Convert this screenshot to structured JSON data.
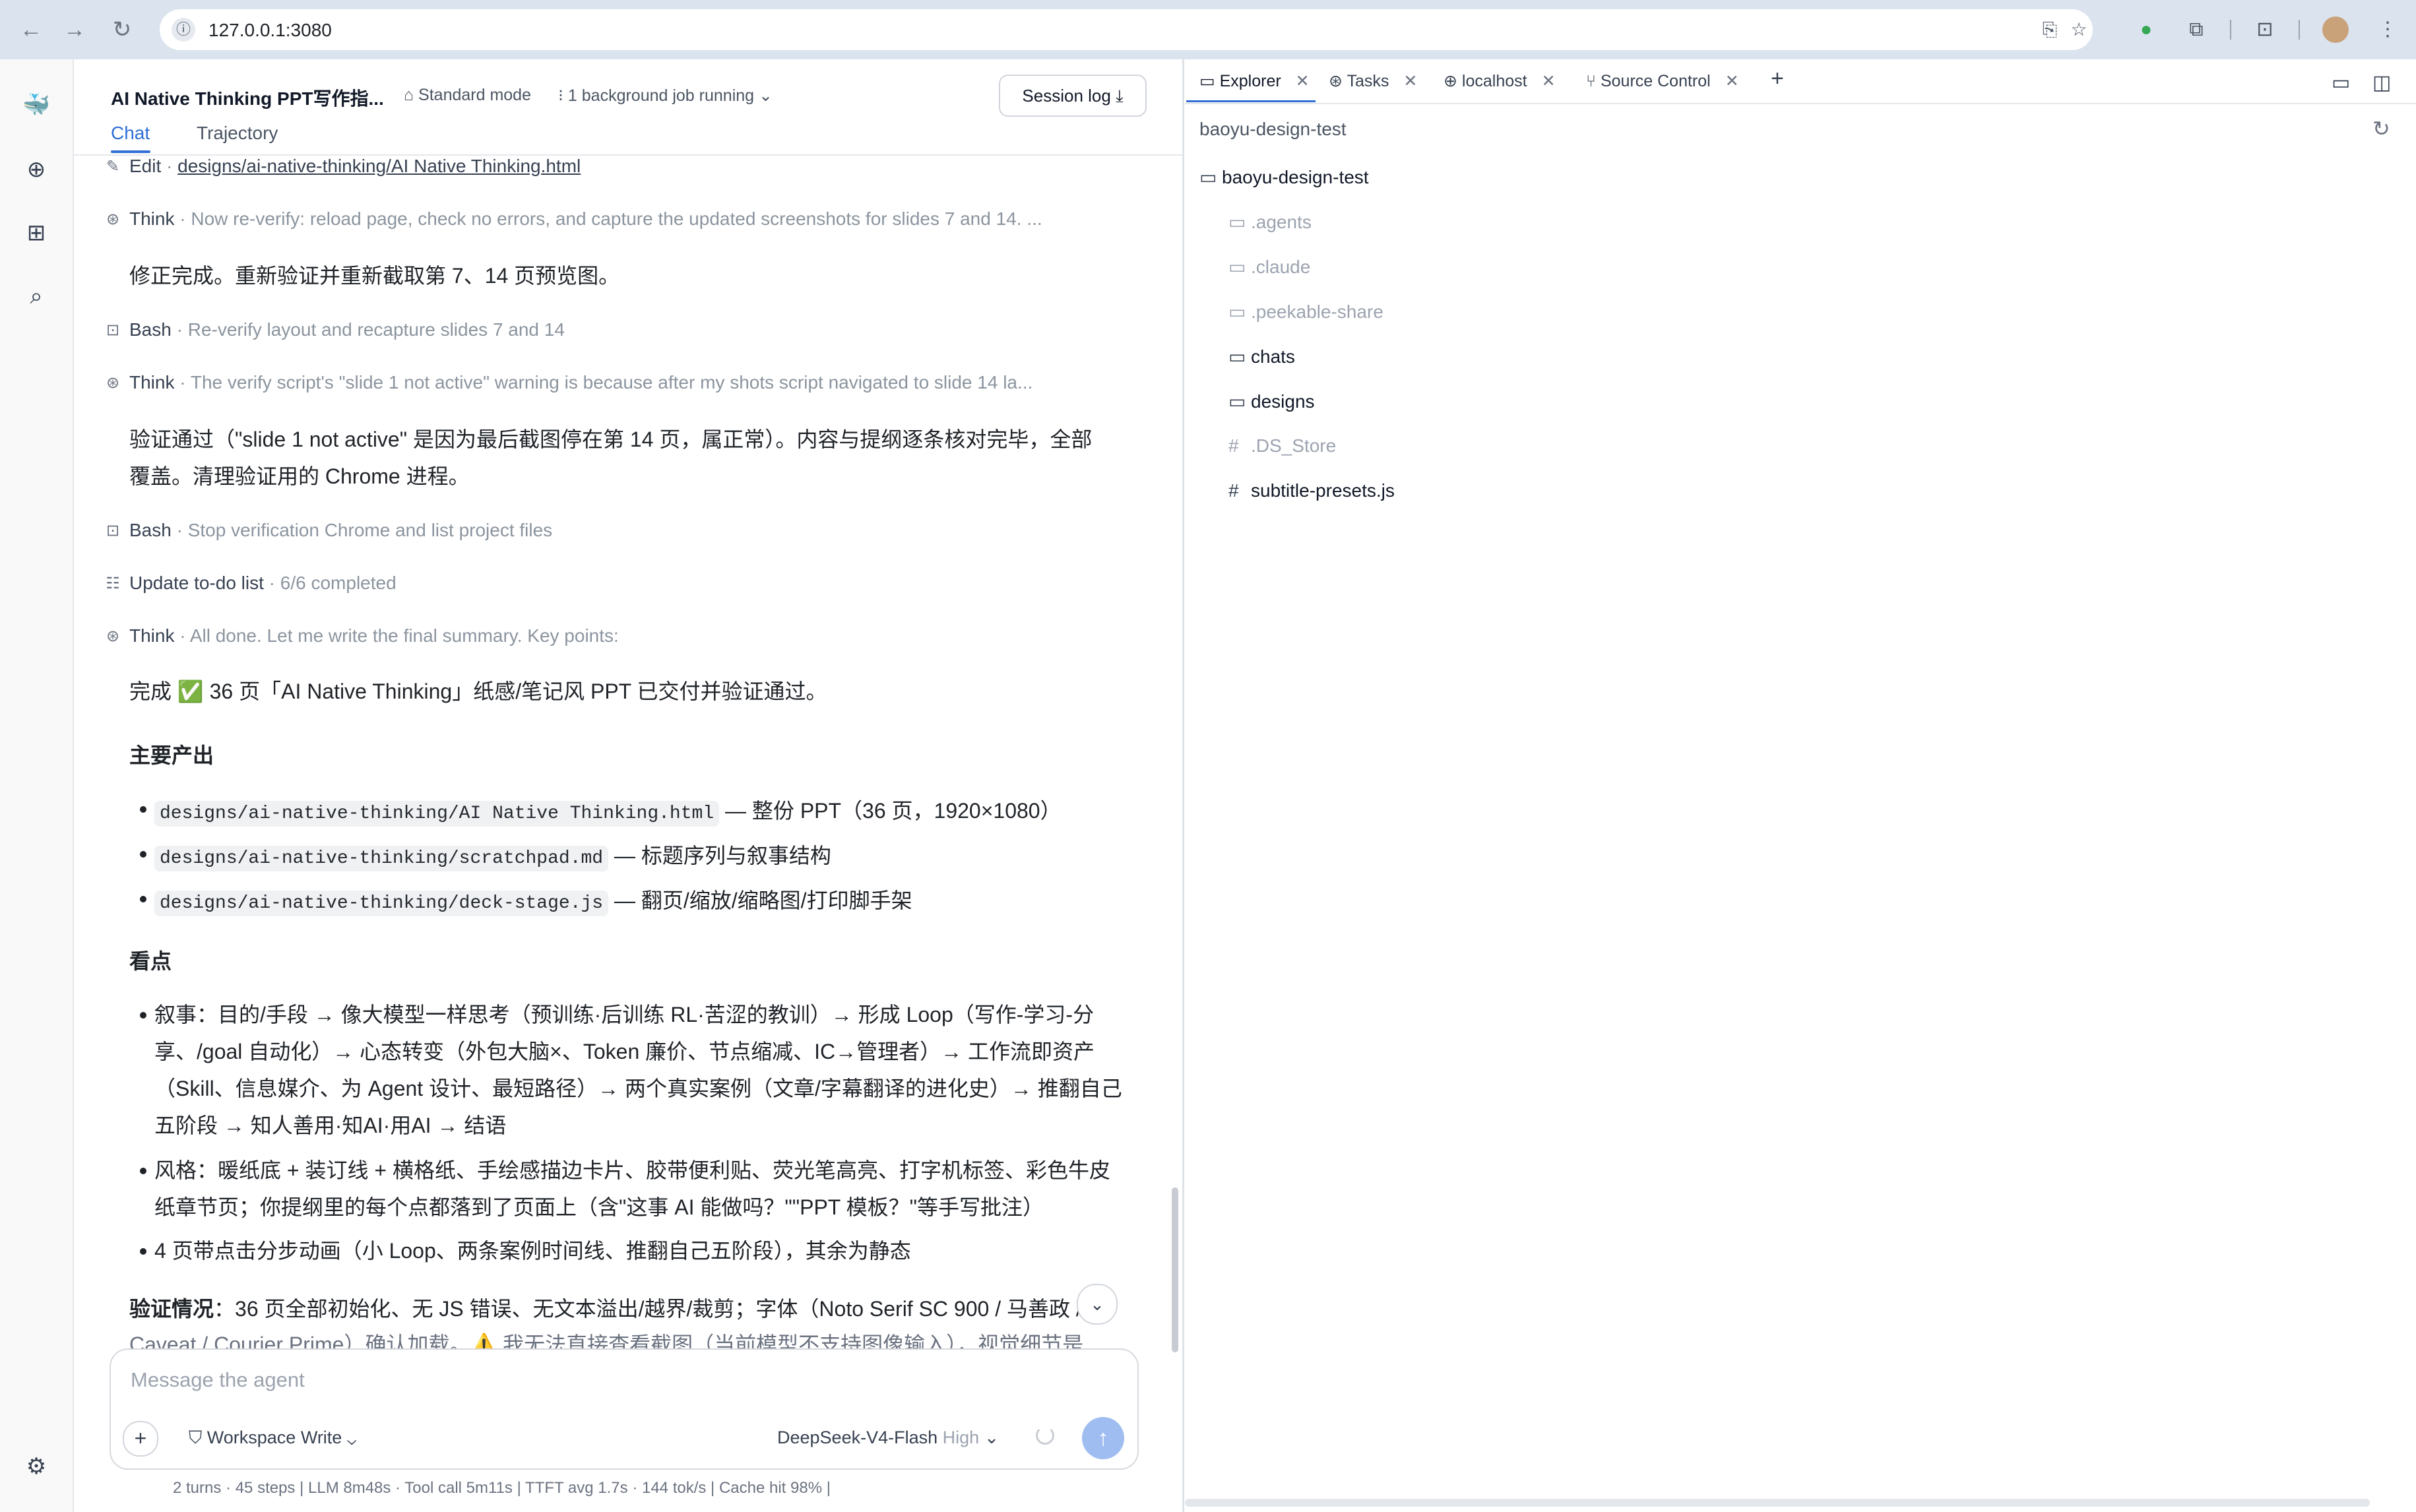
{
  "browser": {
    "url": "127.0.0.1:3080"
  },
  "chat_header": {
    "title": "AI Native Thinking PPT写作指...",
    "mode": "Standard mode",
    "jobs": "1 background job running",
    "session_log": "Session log",
    "tabs": [
      "Chat",
      "Trajectory"
    ]
  },
  "steps": [
    {
      "kind": "Edit",
      "detail": "designs/ai-native-thinking/AI Native Thinking.html"
    },
    {
      "kind": "Think",
      "detail": "Now re-verify: reload page, check no errors, and capture the updated screenshots for slides 7 and 14. ..."
    },
    {
      "kind": "Bash",
      "detail": "Re-verify layout and recapture slides 7 and 14"
    },
    {
      "kind": "Think",
      "detail": "The verify script's \"slide 1 not active\" warning is because after my shots script navigated to slide 14 la..."
    },
    {
      "kind": "Bash",
      "detail": "Stop verification Chrome and list project files"
    },
    {
      "kind": "Update to-do list",
      "detail": "6/6 completed"
    },
    {
      "kind": "Think",
      "detail": "All done. Let me write the final summary. Key points:"
    }
  ],
  "messages": {
    "fix_done": "修正完成。重新验证并重新截取第 7、14 页预览图。",
    "verify_line1": "验证通过（\"slide 1 not active\" 是因为最后截图停在第 14 页，属正常）。内容与提纲逐条核对完毕，全部",
    "verify_line2": "覆盖。清理验证用的 Chrome 进程。",
    "complete": "完成 ✅ 36 页「AI Native Thinking」纸感/笔记风 PPT 已交付并验证通过。",
    "outputs_heading": "主要产出",
    "outputs": [
      {
        "code": "designs/ai-native-thinking/AI Native Thinking.html",
        "text": " — 整份 PPT（36 页，1920×1080）"
      },
      {
        "code": "designs/ai-native-thinking/scratchpad.md",
        "text": " — 标题序列与叙事结构"
      },
      {
        "code": "designs/ai-native-thinking/deck-stage.js",
        "text": " — 翻页/缩放/缩略图/打印脚手架"
      }
    ],
    "highlights_heading": "看点",
    "highlights": [
      {
        "lines": [
          "叙事：目的/手段 → 像大模型一样思考（预训练·后训练 RL·苦涩的教训）→ 形成 Loop（写作-学习-分",
          "享、/goal 自动化）→ 心态转变（外包大脑×、Token 廉价、节点缩减、IC→管理者）→ 工作流即资产",
          "（Skill、信息媒介、为 Agent 设计、最短路径）→ 两个真实案例（文章/字幕翻译的进化史）→ 推翻自己",
          "五阶段 → 知人善用·知AI·用AI → 结语"
        ]
      },
      {
        "lines": [
          "风格：暖纸底 + 装订线 + 横格纸、手绘感描边卡片、胶带便利贴、荧光笔高亮、打字机标签、彩色牛皮",
          "纸章节页；你提纲里的每个点都落到了页面上（含\"这事 AI 能做吗？\"\"PPT 模板？\"等手写批注）"
        ]
      },
      {
        "lines": [
          "4 页带点击分步动画（小 Loop、两条案例时间线、推翻自己五阶段），其余为静态"
        ]
      }
    ],
    "verification_label": "验证情况",
    "verification_text": "：36 页全部初始化、无 JS 错误、无文本溢出/越界/裁剪；字体（Noto Serif SC 900 / 马善政 /",
    "verification_cut": "Caveat / Courier Prime）确认加载。⚠️ 我无法直接查看截图（当前模型不支持图像输入），视觉细节是"
  },
  "composer": {
    "placeholder": "Message the agent",
    "workspace": "Workspace Write",
    "model": "DeepSeek-V4-Flash",
    "level": "High"
  },
  "status": {
    "text": "2 turns · 45 steps   |   LLM 8m48s · Tool call 5m11s   |   TTFT avg 1.7s · 144 tok/s   |   Cache hit 98%   |"
  },
  "explorer": {
    "tabs": [
      "Explorer",
      "Tasks",
      "localhost",
      "Source Control"
    ],
    "root": "baoyu-design-test",
    "tree_root": "baoyu-design-test",
    "items": [
      {
        "name": ".agents",
        "type": "folder",
        "dim": true
      },
      {
        "name": ".claude",
        "type": "folder",
        "dim": true
      },
      {
        "name": ".peekable-share",
        "type": "folder",
        "dim": true
      },
      {
        "name": "chats",
        "type": "folder",
        "dim": false
      },
      {
        "name": "designs",
        "type": "folder",
        "dim": false
      },
      {
        "name": ".DS_Store",
        "type": "file",
        "dim": true
      },
      {
        "name": "subtitle-presets.js",
        "type": "file",
        "dim": false
      }
    ]
  }
}
